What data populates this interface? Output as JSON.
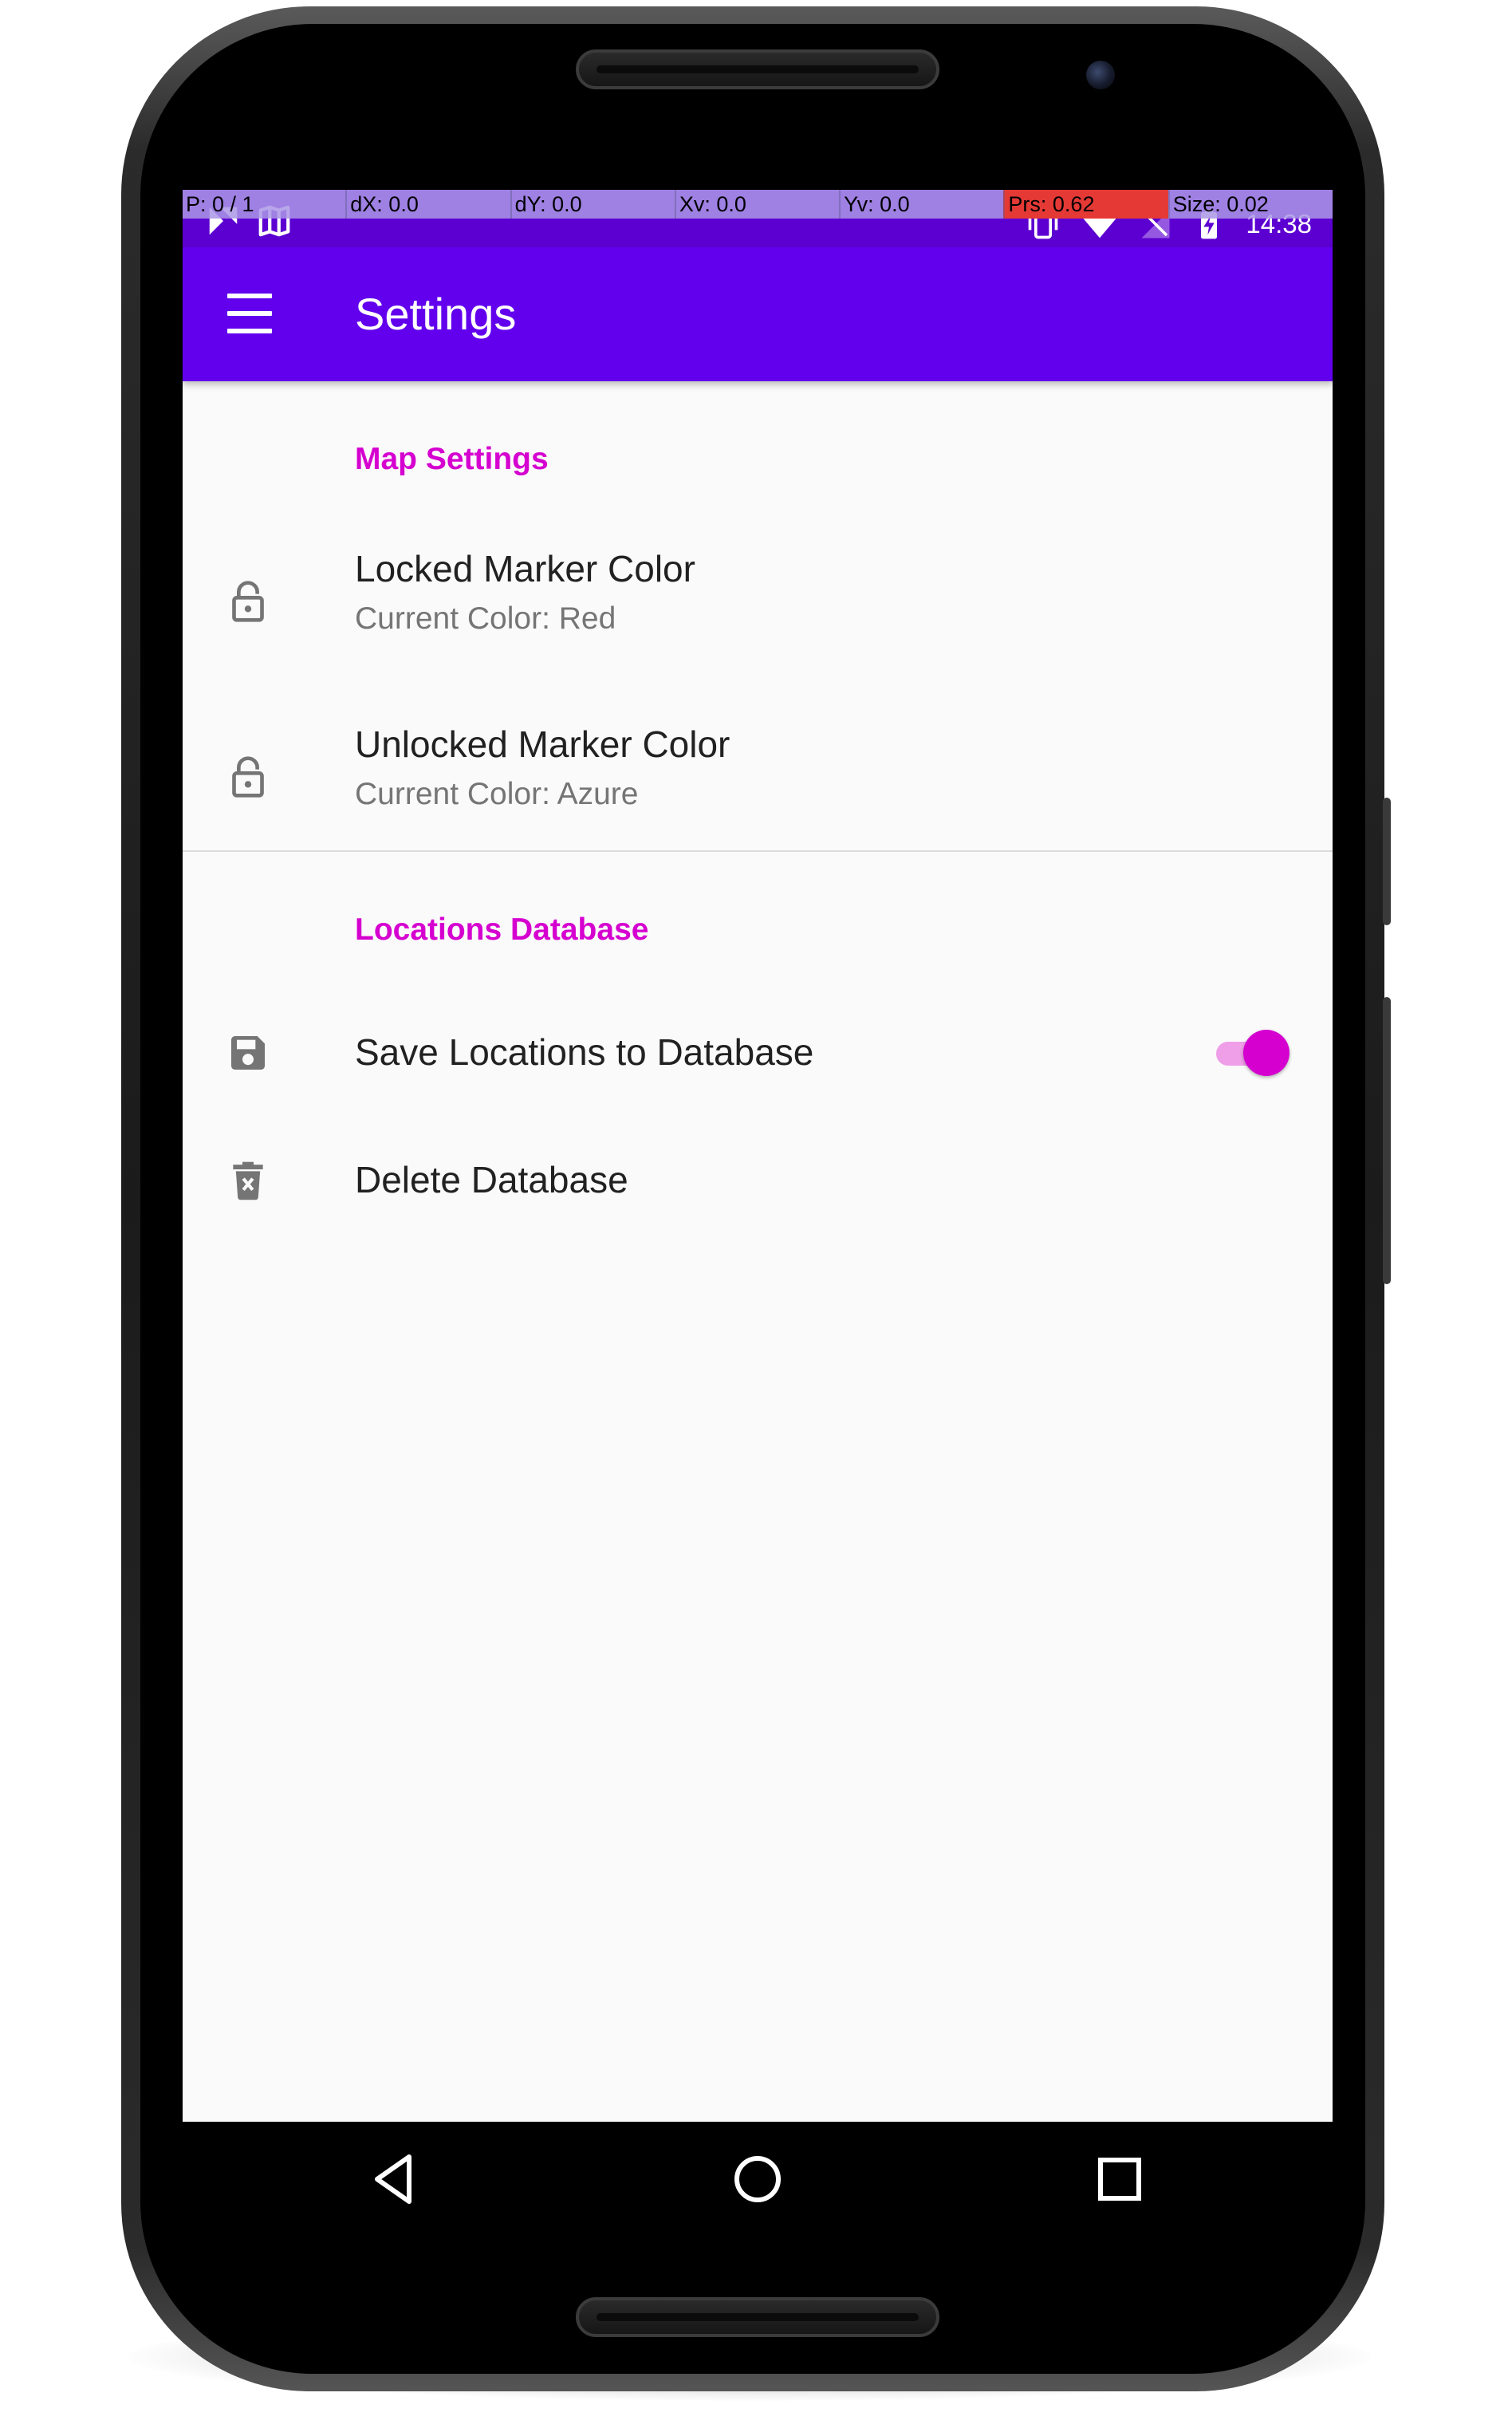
{
  "pointer_overlay": {
    "pointer": "P: 0 / 1",
    "dx": "dX: 0.0",
    "dy": "dY: 0.0",
    "xv": "Xv: 0.0",
    "yv": "Yv: 0.0",
    "prs": "Prs: 0.62",
    "size": "Size: 0.02"
  },
  "status_bar": {
    "time": "14:38",
    "left_icons": [
      "notification-icon",
      "map-icon"
    ],
    "right_icons": [
      "vibrate-icon",
      "wifi-icon",
      "signal-icon",
      "battery-charging-icon"
    ]
  },
  "toolbar": {
    "title": "Settings",
    "nav_icon": "hamburger-menu-icon"
  },
  "sections": [
    {
      "header": "Map Settings",
      "items": [
        {
          "title": "Locked Marker Color",
          "summary": "Current Color: Red",
          "icon": "lock-icon"
        },
        {
          "title": "Unlocked Marker Color",
          "summary": "Current Color: Azure",
          "icon": "lock-icon"
        }
      ]
    },
    {
      "header": "Locations Database",
      "items": [
        {
          "title": "Save Locations to Database",
          "icon": "save-icon",
          "switch_on": true
        },
        {
          "title": "Delete Database",
          "icon": "delete-icon"
        }
      ]
    }
  ],
  "nav_bar": {
    "buttons": [
      "back-icon",
      "home-icon",
      "recents-icon"
    ]
  },
  "colors": {
    "status_bar": "#5c00d1",
    "toolbar": "#6200ee",
    "accent": "#d500d0",
    "background": "#fafafa",
    "pointer_alert": "#e53935"
  }
}
